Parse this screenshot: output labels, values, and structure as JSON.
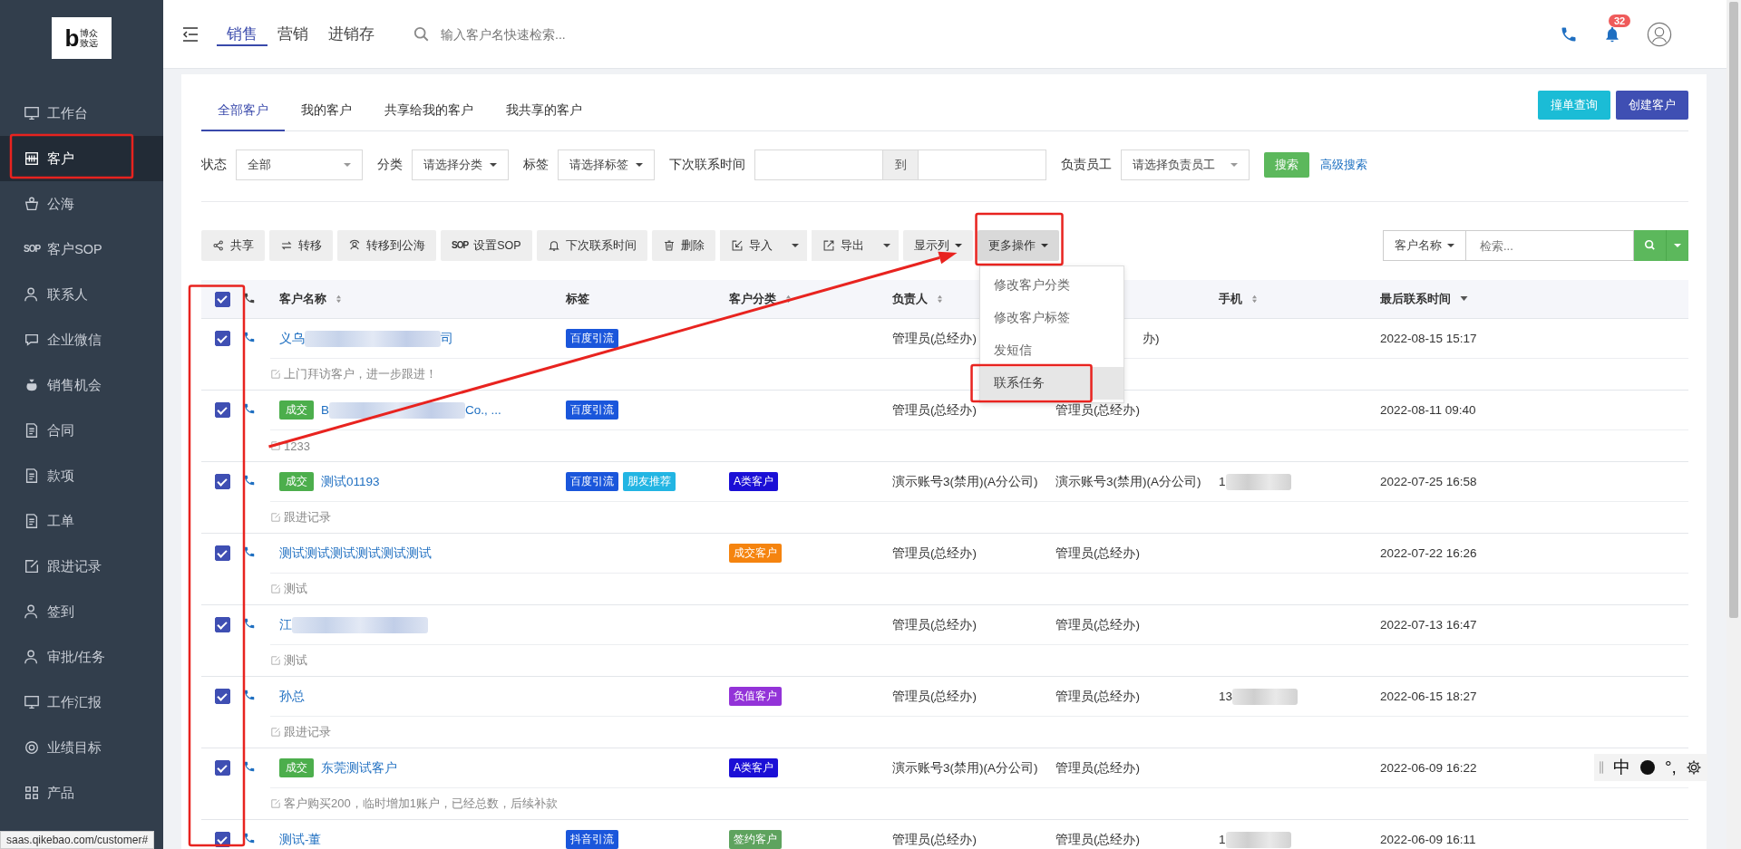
{
  "logo": {
    "mark": "b",
    "lines": [
      "博众",
      "致远"
    ]
  },
  "sidebar": {
    "items": [
      {
        "label": "工作台",
        "selected": false
      },
      {
        "label": "客户",
        "selected": true,
        "annotated": true
      },
      {
        "label": "公海",
        "selected": false
      },
      {
        "label": "客户SOP",
        "selected": false,
        "icon_text": "SOP"
      },
      {
        "label": "联系人",
        "selected": false
      },
      {
        "label": "企业微信",
        "selected": false
      },
      {
        "label": "销售机会",
        "selected": false
      },
      {
        "label": "合同",
        "selected": false
      },
      {
        "label": "款项",
        "selected": false
      },
      {
        "label": "工单",
        "selected": false
      },
      {
        "label": "跟进记录",
        "selected": false
      },
      {
        "label": "签到",
        "selected": false
      },
      {
        "label": "审批/任务",
        "selected": false
      },
      {
        "label": "工作汇报",
        "selected": false
      },
      {
        "label": "业绩目标",
        "selected": false
      },
      {
        "label": "产品",
        "selected": false
      }
    ]
  },
  "topbar": {
    "tabs": [
      {
        "label": "销售",
        "selected": true
      },
      {
        "label": "营销",
        "selected": false
      },
      {
        "label": "进销存",
        "selected": false
      }
    ],
    "search": {
      "placeholder": "输入客户名快速检索..."
    },
    "notification_count": "32"
  },
  "tabs": [
    {
      "label": "全部客户",
      "selected": true
    },
    {
      "label": "我的客户",
      "selected": false
    },
    {
      "label": "共享给我的客户",
      "selected": false
    },
    {
      "label": "我共享的客户",
      "selected": false
    }
  ],
  "header_buttons": [
    {
      "label": "撞单查询",
      "kind": "info"
    },
    {
      "label": "创建客户",
      "kind": "primary"
    }
  ],
  "filters": {
    "status": {
      "label": "状态",
      "value": "全部"
    },
    "category": {
      "label": "分类",
      "value": "请选择分类"
    },
    "tag": {
      "label": "标签",
      "value": "请选择标签"
    },
    "next_contact": {
      "label": "下次联系时间",
      "separator": "到"
    },
    "owner": {
      "label": "负责员工",
      "value": "请选择负责员工"
    },
    "search_button": "搜索",
    "advanced_link": "高级搜索"
  },
  "toolbar": [
    {
      "label": "共享",
      "kind": "share"
    },
    {
      "label": "转移",
      "kind": "transfer"
    },
    {
      "label": "转移到公海",
      "kind": "pool"
    },
    {
      "label": "设置SOP",
      "kind": "sop",
      "icon_text": "SOP"
    },
    {
      "label": "下次联系时间",
      "kind": "bell"
    },
    {
      "label": "删除",
      "kind": "delete"
    },
    {
      "label": "导入",
      "kind": "import",
      "split": true
    },
    {
      "label": "导出",
      "kind": "export",
      "split": true
    },
    {
      "label": "显示列",
      "kind": "dropdown"
    },
    {
      "label": "更多操作",
      "kind": "dropdown",
      "pressed": true,
      "annotated": true
    }
  ],
  "more_menu": {
    "expanded": true,
    "items": [
      {
        "label": "修改客户分类",
        "hovered": false
      },
      {
        "label": "修改客户标签",
        "hovered": false
      },
      {
        "label": "发短信",
        "hovered": false
      },
      {
        "label": "联系任务",
        "hovered": true,
        "annotated": true
      }
    ]
  },
  "quick_search": {
    "field": "客户名称",
    "placeholder": "检索..."
  },
  "table": {
    "all_checked": true,
    "checkbox_column_annotated": true,
    "columns": [
      {
        "label": "客户名称",
        "sortable": true,
        "sorted": false
      },
      {
        "label": "标签",
        "sortable": false
      },
      {
        "label": "客户分类",
        "sortable": true,
        "sorted": false
      },
      {
        "label": "负责人",
        "sortable": true,
        "sorted": false
      },
      {},
      {
        "label": "手机",
        "sortable": true,
        "sorted": false
      },
      {
        "label": "最后联系时间",
        "sortable": true,
        "sorted": true
      }
    ],
    "rows": [
      {
        "checked": true,
        "name_parts": [
          {
            "kind": "text",
            "text": "义乌"
          },
          {
            "kind": "blur"
          },
          {
            "kind": "text",
            "text": "司"
          }
        ],
        "tags": [
          {
            "text": "百度引流",
            "color": "#1a56db"
          }
        ],
        "owner": "管理员(总经办)",
        "column_5": "办)",
        "column_5_covered": true,
        "time": "2022-08-15 15:17",
        "note": "上门拜访客户，进一步跟进！"
      },
      {
        "checked": true,
        "status": "成交",
        "name_parts": [
          {
            "kind": "text",
            "text": "B"
          },
          {
            "kind": "blur"
          },
          {
            "kind": "text",
            "text": "Co., ..."
          }
        ],
        "tags": [
          {
            "text": "百度引流",
            "color": "#1a56db"
          }
        ],
        "owner": "管理员(总经办)",
        "column_5": "管理员(总经办)",
        "time": "2022-08-11 09:40",
        "note": "1233"
      },
      {
        "checked": true,
        "status": "成交",
        "name_parts": [
          {
            "kind": "text",
            "text": "测试01193"
          }
        ],
        "tags": [
          {
            "text": "百度引流",
            "color": "#1a56db"
          },
          {
            "text": "朋友推荐",
            "color": "#22b5e3"
          }
        ],
        "category": {
          "text": "A类客户",
          "color": "#1b0fd6"
        },
        "owner": "演示账号3(禁用)(A分公司)",
        "column_5": "演示账号3(禁用)(A分公司)",
        "phone_parts": [
          {
            "kind": "text",
            "text": "1"
          },
          {
            "kind": "blur"
          }
        ],
        "time": "2022-07-25 16:58",
        "note": "跟进记录"
      },
      {
        "checked": true,
        "name_parts": [
          {
            "kind": "text",
            "text": "测试测试测试测试测试测试"
          }
        ],
        "tags": [],
        "category": {
          "text": "成交客户",
          "color": "#f5840f"
        },
        "owner": "管理员(总经办)",
        "column_5": "管理员(总经办)",
        "time": "2022-07-22 16:26",
        "note": "测试"
      },
      {
        "checked": true,
        "name_parts": [
          {
            "kind": "text",
            "text": "江"
          },
          {
            "kind": "blur"
          }
        ],
        "tags": [],
        "owner": "管理员(总经办)",
        "column_5": "管理员(总经办)",
        "time": "2022-07-13 16:47",
        "note": "测试"
      },
      {
        "checked": true,
        "name_parts": [
          {
            "kind": "text",
            "text": "孙总"
          }
        ],
        "tags": [],
        "category": {
          "text": "负值客户",
          "color": "#9333d8"
        },
        "owner": "管理员(总经办)",
        "column_5": "管理员(总经办)",
        "phone_parts": [
          {
            "kind": "text",
            "text": "13"
          },
          {
            "kind": "blur"
          }
        ],
        "time": "2022-06-15 18:27",
        "note": "跟进记录"
      },
      {
        "checked": true,
        "status": "成交",
        "name_parts": [
          {
            "kind": "text",
            "text": "东莞测试客户"
          }
        ],
        "tags": [],
        "category": {
          "text": "A类客户",
          "color": "#1b0fd6"
        },
        "owner": "演示账号3(禁用)(A分公司)",
        "column_5": "管理员(总经办)",
        "time": "2022-06-09 16:22",
        "note": "客户购买200，临时增加1账户，已经总数，后续补款"
      },
      {
        "checked": true,
        "name_parts": [
          {
            "kind": "text",
            "text": "测试-董"
          }
        ],
        "tags": [
          {
            "text": "抖音引流",
            "color": "#1a56db"
          }
        ],
        "category": {
          "text": "签约客户",
          "color": "#5ea35e"
        },
        "owner": "管理员(总经办)",
        "column_5": "管理员(总经办)",
        "phone_parts": [
          {
            "kind": "text",
            "text": "1"
          },
          {
            "kind": "blur"
          }
        ],
        "time": "2022-06-09 16:11"
      }
    ]
  },
  "annotation_arrow": true,
  "link_preview": "saas.qikebao.com/customer#",
  "ime_toolbar": {
    "mode": "中",
    "punctuation": "°,"
  }
}
